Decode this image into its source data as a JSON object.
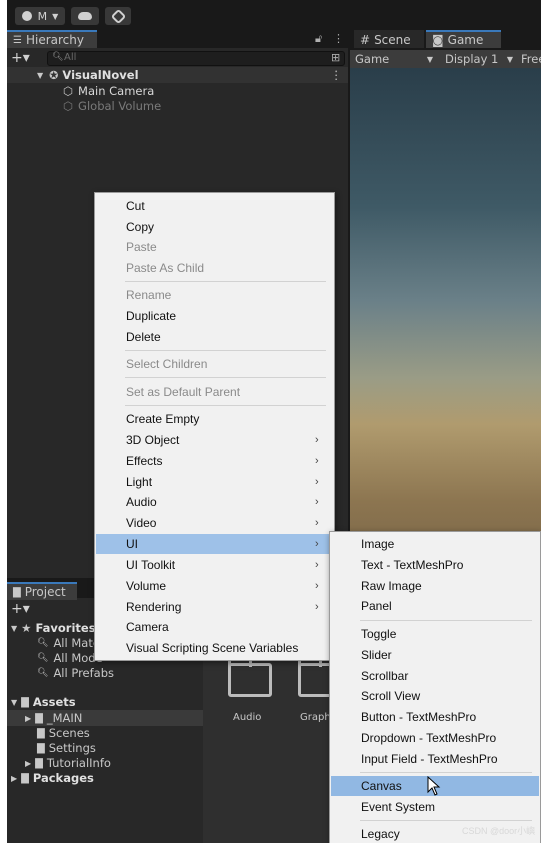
{
  "toolbar": {
    "account_label": "M",
    "cloud_icon": "cloud-icon",
    "collab_icon": "collab-icon"
  },
  "hierarchy": {
    "tab_label": "Hierarchy",
    "search_placeholder": "All",
    "scene_name": "VisualNovel",
    "items": [
      {
        "label": "Main Camera"
      },
      {
        "label": "Global Volume"
      }
    ]
  },
  "scene_tabs": {
    "scene": "Scene",
    "game": "Game",
    "game_dropdown": "Game",
    "display_dropdown": "Display 1",
    "free_label": "Free"
  },
  "project": {
    "tab_label": "Project",
    "favorites_label": "Favorites",
    "favorites": [
      "All Mate",
      "All Mode",
      "All Prefabs"
    ],
    "assets_label": "Assets",
    "assets": [
      "_MAIN",
      "Scenes",
      "Settings",
      "TutorialInfo"
    ],
    "packages_label": "Packages",
    "grid_items": [
      "Audio",
      "Graph"
    ]
  },
  "context_menu": {
    "items": [
      {
        "label": "Cut",
        "disabled": false
      },
      {
        "label": "Copy",
        "disabled": false
      },
      {
        "label": "Paste",
        "disabled": true
      },
      {
        "label": "Paste As Child",
        "disabled": true
      },
      {
        "label": "Rename",
        "disabled": true
      },
      {
        "label": "Duplicate",
        "disabled": false
      },
      {
        "label": "Delete",
        "disabled": false
      },
      {
        "label": "Select Children",
        "disabled": true
      },
      {
        "label": "Set as Default Parent",
        "disabled": true
      },
      {
        "label": "Create Empty",
        "disabled": false
      },
      {
        "label": "3D Object",
        "disabled": false,
        "submenu": true
      },
      {
        "label": "Effects",
        "disabled": false,
        "submenu": true
      },
      {
        "label": "Light",
        "disabled": false,
        "submenu": true
      },
      {
        "label": "Audio",
        "disabled": false,
        "submenu": true
      },
      {
        "label": "Video",
        "disabled": false,
        "submenu": true
      },
      {
        "label": "UI",
        "disabled": false,
        "submenu": true,
        "highlighted": true
      },
      {
        "label": "UI Toolkit",
        "disabled": false,
        "submenu": true
      },
      {
        "label": "Volume",
        "disabled": false,
        "submenu": true
      },
      {
        "label": "Rendering",
        "disabled": false,
        "submenu": true
      },
      {
        "label": "Camera",
        "disabled": false
      },
      {
        "label": "Visual Scripting Scene Variables",
        "disabled": false
      }
    ]
  },
  "ui_submenu": {
    "items": [
      {
        "label": "Image"
      },
      {
        "label": "Text - TextMeshPro"
      },
      {
        "label": "Raw Image"
      },
      {
        "label": "Panel"
      },
      {
        "label": "Toggle"
      },
      {
        "label": "Slider"
      },
      {
        "label": "Scrollbar"
      },
      {
        "label": "Scroll View"
      },
      {
        "label": "Button - TextMeshPro"
      },
      {
        "label": "Dropdown - TextMeshPro"
      },
      {
        "label": "Input Field - TextMeshPro"
      },
      {
        "label": "Canvas",
        "highlighted": true
      },
      {
        "label": "Event System"
      },
      {
        "label": "Legacy"
      }
    ]
  },
  "watermark": "CSDN @door小嶼",
  "colors": {
    "menu_highlight": "#9ec1e8",
    "selection": "#2c5d87",
    "editor_bg": "#282828"
  }
}
